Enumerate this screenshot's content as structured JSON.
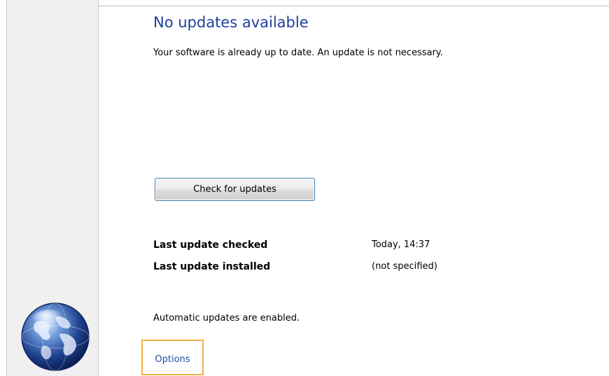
{
  "status": {
    "title": "No updates available",
    "message": "Your software is already up to date. An update is not necessary."
  },
  "actions": {
    "check_button_label": "Check for updates"
  },
  "info": {
    "rows": [
      {
        "label": "Last update checked",
        "value": "Today, 14:37"
      },
      {
        "label": "Last update installed",
        "value": "(not specified)"
      }
    ]
  },
  "auto_update": {
    "text": "Automatic updates are enabled."
  },
  "options": {
    "label": "Options"
  },
  "colors": {
    "title": "#1e3f9e",
    "link": "#1d4fa6",
    "focus_outline": "#f0b040",
    "button_border": "#3d7bad",
    "sidebar_bg": "#f0f0f0"
  },
  "icons": {
    "sidebar_icon": "globe-icon"
  }
}
